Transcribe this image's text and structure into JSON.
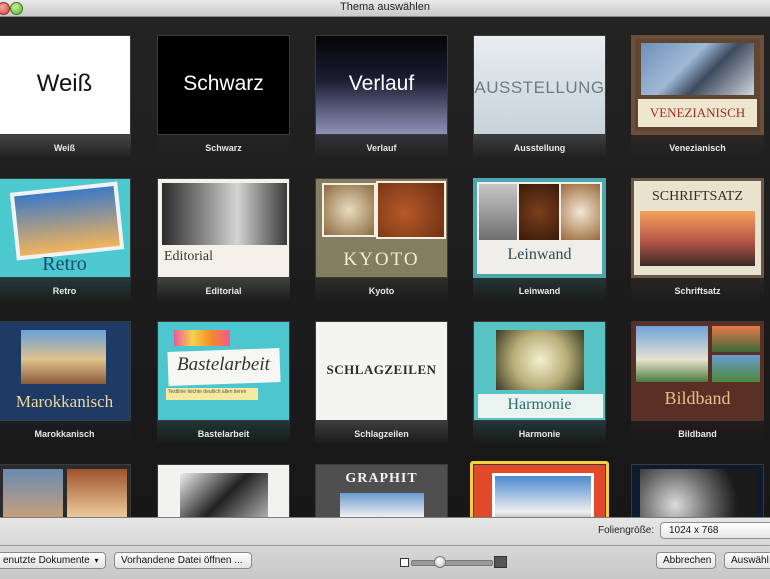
{
  "window": {
    "title": "Thema auswählen"
  },
  "themes": [
    {
      "id": "weiss",
      "label": "Weiß",
      "thumb_text": "Weiß"
    },
    {
      "id": "schwarz",
      "label": "Schwarz",
      "thumb_text": "Schwarz"
    },
    {
      "id": "verlauf",
      "label": "Verlauf",
      "thumb_text": "Verlauf"
    },
    {
      "id": "ausstellung",
      "label": "Ausstellung",
      "thumb_text": "AUSSTELLUNG"
    },
    {
      "id": "venezianisch",
      "label": "Venezianisch",
      "thumb_text": "VENEZIANISCH"
    },
    {
      "id": "retro",
      "label": "Retro",
      "thumb_text": "Retro"
    },
    {
      "id": "editorial",
      "label": "Editorial",
      "thumb_text": "Editorial"
    },
    {
      "id": "kyoto",
      "label": "Kyoto",
      "thumb_text": "KYOTO"
    },
    {
      "id": "leinwand",
      "label": "Leinwand",
      "thumb_text": "Leinwand"
    },
    {
      "id": "schriftsatz",
      "label": "Schriftsatz",
      "thumb_text": "SCHRIFTSATZ"
    },
    {
      "id": "marokkanisch",
      "label": "Marokkanisch",
      "thumb_text": "Marokkanisch"
    },
    {
      "id": "bastelarbeit",
      "label": "Bastelarbeit",
      "thumb_text": "Bastelarbeit",
      "thumb_subtext": "Textlinie leichte deutlich allen tieren"
    },
    {
      "id": "schlagzeilen",
      "label": "Schlagzeilen",
      "thumb_text": "SCHLAGZEILEN"
    },
    {
      "id": "harmonie",
      "label": "Harmonie",
      "thumb_text": "Harmonie"
    },
    {
      "id": "bildband",
      "label": "Bildband",
      "thumb_text": "Bildband"
    },
    {
      "id": "row4-1",
      "label": "",
      "thumb_text": ""
    },
    {
      "id": "row4-2",
      "label": "",
      "thumb_text": ""
    },
    {
      "id": "graphit",
      "label": "",
      "thumb_text": "GRAPHIT"
    },
    {
      "id": "row4-4",
      "label": "",
      "thumb_text": "",
      "selected": true
    },
    {
      "id": "row4-5",
      "label": "",
      "thumb_text": ""
    }
  ],
  "bottom_bar": {
    "size_label": "Foliengröße:",
    "size_value": "1024 x 768",
    "recent_button": "enutzte Dokumente",
    "open_button": "Vorhandene Datei öffnen ...",
    "cancel_button": "Abbrechen",
    "choose_button": "Auswähl"
  },
  "zoom_slider": {
    "value": 0.35
  },
  "colors": {
    "selection": "#f2d23a",
    "window_bg": "#1b1b1b"
  }
}
